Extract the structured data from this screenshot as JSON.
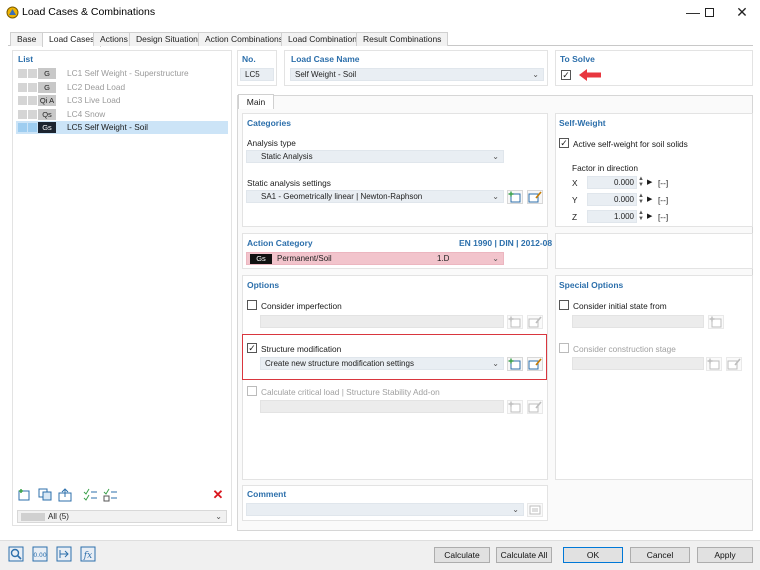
{
  "window": {
    "title": "Load Cases & Combinations",
    "icon": "app-icon",
    "controls": [
      "minimize-icon",
      "maximize-icon",
      "close-icon"
    ]
  },
  "tabs": [
    {
      "label": "Base"
    },
    {
      "label": "Load Cases",
      "active": true
    },
    {
      "label": "Actions"
    },
    {
      "label": "Design Situations"
    },
    {
      "label": "Action Combinations"
    },
    {
      "label": "Load Combinations"
    },
    {
      "label": "Result Combinations"
    }
  ],
  "list": {
    "title": "List",
    "items": [
      {
        "code": "G",
        "lc": "LC1",
        "name": "Self Weight - Superstructure",
        "greyed": true
      },
      {
        "code": "G",
        "lc": "LC2",
        "name": "Dead Load",
        "greyed": true
      },
      {
        "code": "Qi A",
        "lc": "LC3",
        "name": "Live Load",
        "greyed": true
      },
      {
        "code": "Qs",
        "lc": "LC4",
        "name": "Snow",
        "greyed": true
      },
      {
        "code": "Gs",
        "lc": "LC5",
        "name": "Self Weight - Soil",
        "selected": true
      }
    ],
    "filter": "All (5)"
  },
  "header": {
    "no_label": "No.",
    "no_value": "LC5",
    "name_label": "Load Case Name",
    "name_value": "Self Weight - Soil",
    "solve_label": "To Solve",
    "solve_checked": true
  },
  "main_tab": "Main",
  "categories": {
    "title": "Categories",
    "analysis_type_label": "Analysis type",
    "analysis_type_value": "Static Analysis",
    "static_settings_label": "Static analysis settings",
    "static_settings_value": "SA1 - Geometrically linear | Newton-Raphson"
  },
  "self_weight": {
    "title": "Self-Weight",
    "active_label": "Active self-weight for soil solids",
    "active_checked": true,
    "factor_label": "Factor in direction",
    "factors": [
      {
        "axis": "X",
        "value": "0.000",
        "unit": "[--]"
      },
      {
        "axis": "Y",
        "value": "0.000",
        "unit": "[--]"
      },
      {
        "axis": "Z",
        "value": "1.000",
        "unit": "[--]"
      }
    ]
  },
  "action_category": {
    "title": "Action Category",
    "standard": "EN 1990 | DIN | 2012-08",
    "code": "Gs",
    "value": "Permanent/Soil",
    "factor": "1.D",
    "color": "#f2c4cc"
  },
  "options": {
    "title": "Options",
    "imperfection_label": "Consider imperfection",
    "structure_mod_label": "Structure modification",
    "structure_mod_checked": true,
    "structure_mod_value": "Create new structure modification settings",
    "critical_label": "Calculate critical load | Structure Stability Add-on"
  },
  "special": {
    "title": "Special Options",
    "initial_state_label": "Consider initial state from",
    "construction_stage_label": "Consider construction stage"
  },
  "comment": {
    "title": "Comment",
    "value": ""
  },
  "buttons": {
    "calculate": "Calculate",
    "calculate_all": "Calculate All",
    "ok": "OK",
    "cancel": "Cancel",
    "apply": "Apply"
  },
  "colors": {
    "section_title": "#2c6fab",
    "highlight_border": "#d9363e",
    "arrow": "#e8373f",
    "selection": "#cce4f7"
  }
}
